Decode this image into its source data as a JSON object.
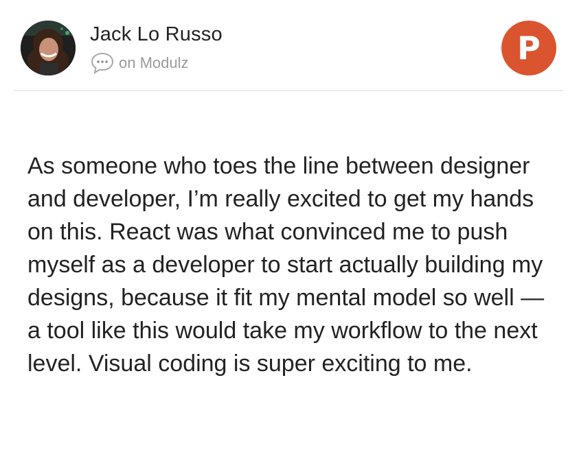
{
  "author": {
    "name": "Jack Lo Russo",
    "avatar_icon": "avatar"
  },
  "source": {
    "icon": "comment-bubble-icon",
    "text": "on Modulz"
  },
  "brand": {
    "logo_letter": "P",
    "logo_color": "#da552f",
    "logo_icon": "product-hunt-icon"
  },
  "testimonial": {
    "text": "As someone who toes the line between designer and developer, I’m really excited to get my hands on this. React was what convinced me to push myself as a developer to start actually building my designs, because it fit my mental model so well — a tool like this would take my workflow to the next level. Visual coding is super exciting to me."
  }
}
